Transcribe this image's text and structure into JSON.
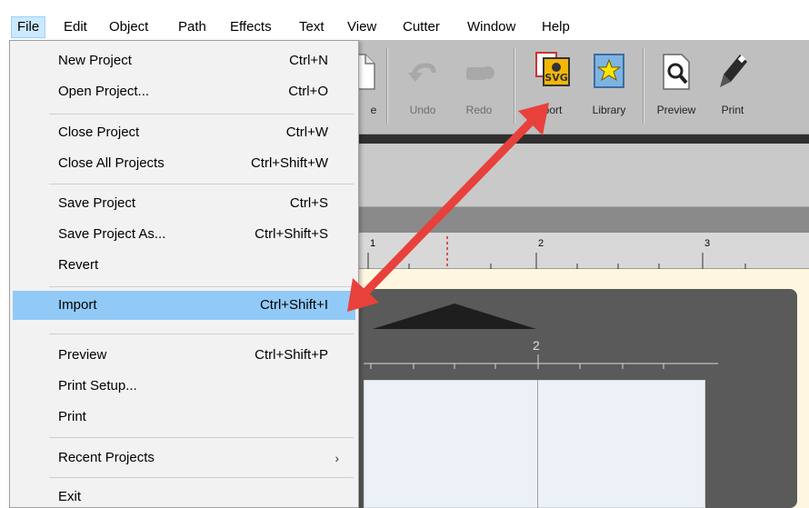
{
  "menubar": {
    "items": [
      {
        "label": "File"
      },
      {
        "label": "Edit"
      },
      {
        "label": "Object"
      },
      {
        "label": "Path"
      },
      {
        "label": "Effects"
      },
      {
        "label": "Text"
      },
      {
        "label": "View"
      },
      {
        "label": "Cutter"
      },
      {
        "label": "Window"
      },
      {
        "label": "Help"
      }
    ]
  },
  "toolbar": {
    "buttons": [
      {
        "label": "e",
        "icon": "document-icon"
      },
      {
        "label": "Undo",
        "icon": "undo-icon"
      },
      {
        "label": "Redo",
        "icon": "redo-icon"
      },
      {
        "label": "port",
        "icon": "svg-import-icon"
      },
      {
        "label": "Library",
        "icon": "star-library-icon"
      },
      {
        "label": "Preview",
        "icon": "magnifier-page-icon"
      },
      {
        "label": "Print",
        "icon": "pen-cutter-icon"
      }
    ]
  },
  "ruler": {
    "ticks": [
      "1",
      "2",
      "3"
    ]
  },
  "mat_ruler": {
    "ticks": [
      "2"
    ]
  },
  "file_menu": {
    "items": [
      {
        "label": "New Project",
        "shortcut": "Ctrl+N"
      },
      {
        "label": "Open Project...",
        "shortcut": "Ctrl+O"
      },
      {
        "label": "Close Project",
        "shortcut": "Ctrl+W"
      },
      {
        "label": "Close All Projects",
        "shortcut": "Ctrl+Shift+W"
      },
      {
        "label": "Save Project",
        "shortcut": "Ctrl+S"
      },
      {
        "label": "Save Project As...",
        "shortcut": "Ctrl+Shift+S"
      },
      {
        "label": "Revert",
        "shortcut": ""
      },
      {
        "label": "Import",
        "shortcut": "Ctrl+Shift+I"
      },
      {
        "label": "Preview",
        "shortcut": "Ctrl+Shift+P"
      },
      {
        "label": "Print Setup...",
        "shortcut": ""
      },
      {
        "label": "Print",
        "shortcut": ""
      },
      {
        "label": "Recent Projects",
        "shortcut": "",
        "submenu_arrow": "›"
      },
      {
        "label": "Exit",
        "shortcut": ""
      }
    ]
  },
  "colors": {
    "menu_highlight": "#91c9f7",
    "annotation_arrow": "#e8413c",
    "toolbar_bg": "#bfbfbf"
  }
}
